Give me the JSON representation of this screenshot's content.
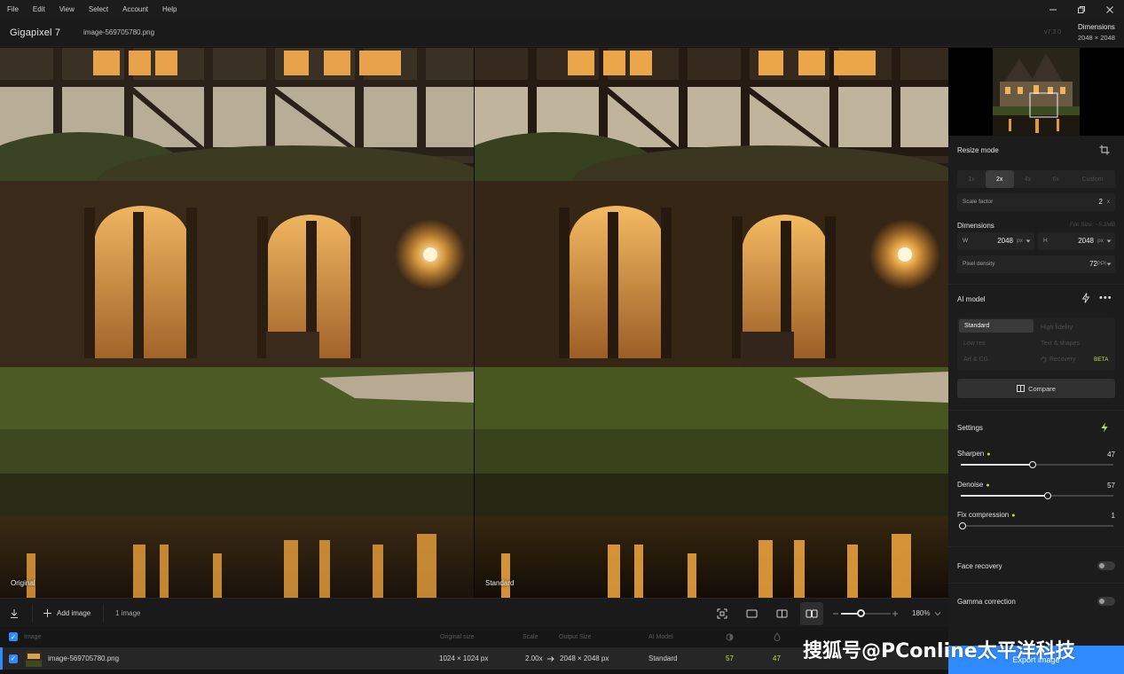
{
  "menu": [
    "File",
    "Edit",
    "View",
    "Select",
    "Account",
    "Help"
  ],
  "window_controls": [
    "minimize-icon",
    "restore-icon",
    "close-icon"
  ],
  "titlebar": {
    "app_name": "Gigapixel 7",
    "file_name": "image-569705780.png",
    "version": "v7.3.0",
    "dimensions_label": "Dimensions",
    "dimensions_value": "2048 × 2048"
  },
  "preview": {
    "left_label": "Original",
    "right_label": "Standard"
  },
  "toolbar": {
    "add_image": "Add image",
    "image_count": "1 image",
    "zoom_value": "180%",
    "zoom_level": 0.4
  },
  "table": {
    "headers": {
      "image": "Image",
      "original_size": "Original size",
      "scale": "Scale",
      "output_size": "Output Size",
      "ai_model": "AI Model"
    },
    "row": {
      "file_name": "image-569705780.png",
      "original_size": "1024 × 1024 px",
      "scale": "2.00x",
      "output_size": "2048 × 2048 px",
      "ai_model": "Standard",
      "sharpen": "57",
      "denoise": "47"
    }
  },
  "panel": {
    "resize_mode_title": "Resize mode",
    "scale_options": [
      "1x",
      "2x",
      "4x",
      "6x",
      "Custom"
    ],
    "scale_selected": "2x",
    "scale_factor_label": "Scale factor",
    "scale_factor_value": "2",
    "scale_factor_unit": "x",
    "dimensions_title": "Dimensions",
    "file_size": "File Size: ~5.2MB",
    "width_label": "W",
    "width_value": "2048",
    "width_unit": "px",
    "height_label": "H",
    "height_value": "2048",
    "height_unit": "px",
    "pixel_density_label": "Pixel density",
    "pixel_density_value": "72",
    "pixel_density_unit": "PPI",
    "ai_model_title": "AI model",
    "models": {
      "standard": "Standard",
      "high_fidelity": "High fidelity",
      "low_res": "Low res",
      "text_shapes": "Text & shapes",
      "art_cg": "Art & CG",
      "recovery": "Recovery",
      "beta": "BETA"
    },
    "compare_label": "Compare",
    "settings_title": "Settings",
    "sharpen_label": "Sharpen",
    "sharpen_value": "47",
    "sharpen_level": 0.47,
    "denoise_label": "Denoise",
    "denoise_value": "57",
    "denoise_level": 0.57,
    "fix_compression_label": "Fix compression",
    "fix_compression_value": "1",
    "fix_compression_level": 0.01,
    "face_recovery_label": "Face recovery",
    "gamma_label": "Gamma correction",
    "export_label": "Export image"
  },
  "colors": {
    "accent": "#2f8bff",
    "lime": "#b6e24a",
    "panel_bg": "#1c1c1c"
  },
  "watermark": "搜狐号@PConline太平洋科技"
}
